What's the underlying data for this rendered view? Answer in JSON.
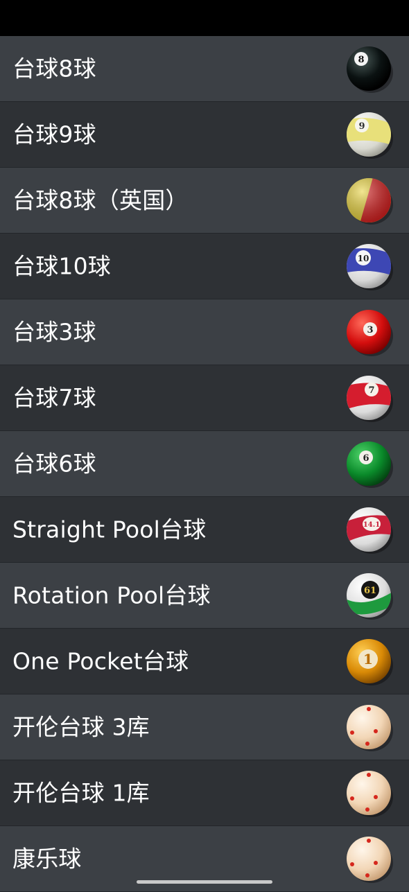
{
  "items": [
    {
      "label": "台球8球",
      "ball": "eight-ball",
      "number": "8"
    },
    {
      "label": "台球9球",
      "ball": "nine-ball",
      "number": "9"
    },
    {
      "label": "台球8球（英国）",
      "ball": "uk-eight-ball",
      "number": ""
    },
    {
      "label": "台球10球",
      "ball": "ten-ball",
      "number": "10"
    },
    {
      "label": "台球3球",
      "ball": "three-ball",
      "number": "3"
    },
    {
      "label": "台球7球",
      "ball": "seven-ball",
      "number": "7"
    },
    {
      "label": "台球6球",
      "ball": "six-ball",
      "number": "6"
    },
    {
      "label": "Straight Pool台球",
      "ball": "straight-pool-ball",
      "number": "14.1"
    },
    {
      "label": "Rotation Pool台球",
      "ball": "rotation-pool-ball",
      "number": "61"
    },
    {
      "label": "One Pocket台球",
      "ball": "one-pocket-ball",
      "number": "1"
    },
    {
      "label": "开伦台球 3库",
      "ball": "carom-ball",
      "number": ""
    },
    {
      "label": "开伦台球 1库",
      "ball": "carom-ball",
      "number": ""
    },
    {
      "label": "康乐球",
      "ball": "carom-ball",
      "number": ""
    }
  ],
  "colors": {
    "row_light": "#3c4045",
    "row_dark": "#2e3135",
    "text": "#ffffff",
    "status_bar": "#000000"
  }
}
